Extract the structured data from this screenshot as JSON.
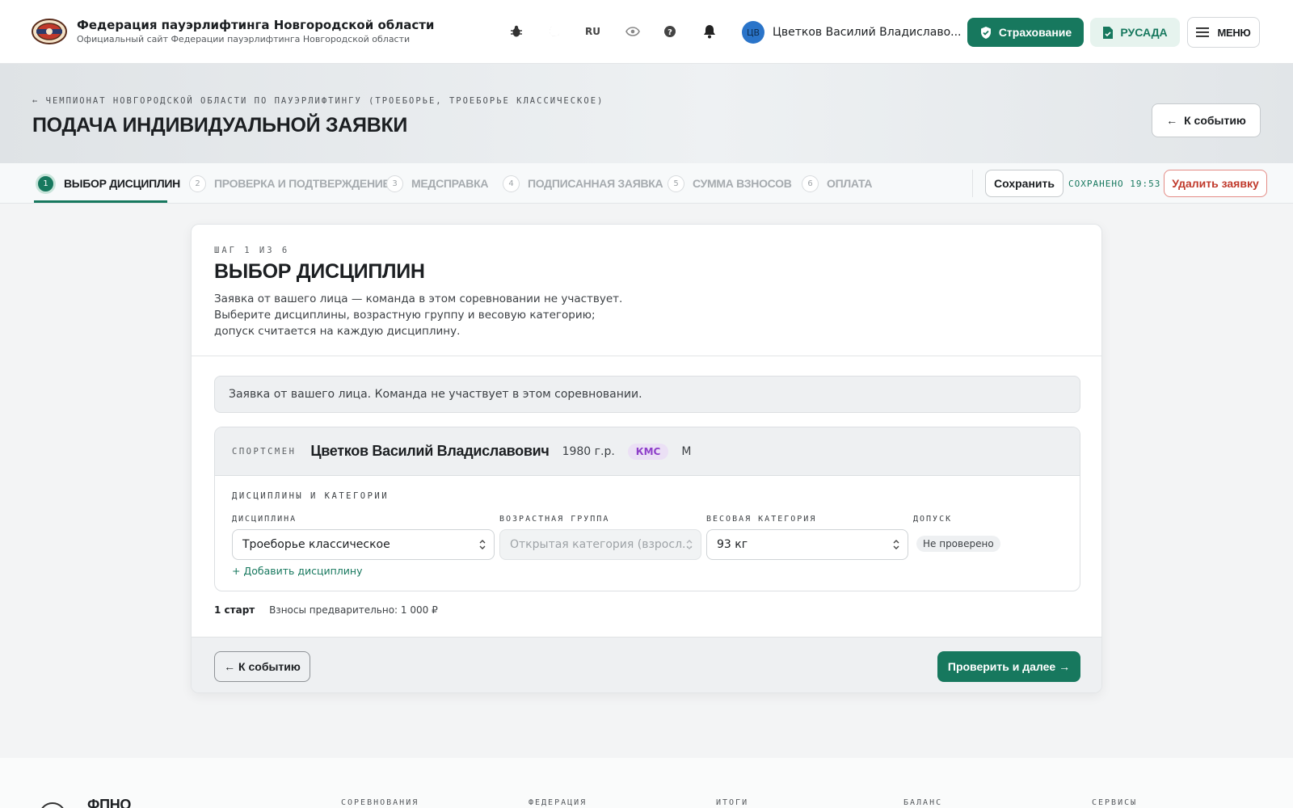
{
  "header": {
    "org_name": "Федерация пауэрлифтинга Новгородской области",
    "org_sub": "Официальный сайт Федерации пауэрлифтинга Новгородской области",
    "lang": "RU",
    "user_initials": "ЦВ",
    "user_name": "Цветков Василий Владиславо...",
    "insurance_label": "Страхование",
    "rusada_label": "РУСАДА",
    "menu_label": "МЕНЮ",
    "icons": [
      "bug-icon",
      "moon-icon",
      "eye-icon",
      "help-icon",
      "bell-icon"
    ]
  },
  "hero": {
    "breadcrumb": "ЧЕМПИОНАТ НОВГОРОДСКОЙ ОБЛАСТИ ПО ПАУЭРЛИФТИНГУ (ТРОЕБОРЬЕ, ТРОЕБОРЬЕ КЛАССИЧЕСКОЕ)",
    "title": "ПОДАЧА ИНДИВИДУАЛЬНОЙ ЗАЯВКИ",
    "back_label": "К событию"
  },
  "steps": [
    {
      "num": "1",
      "label": "ВЫБОР ДИСЦИПЛИН"
    },
    {
      "num": "2",
      "label": "ПРОВЕРКА И ПОДТВЕРЖДЕНИЕ"
    },
    {
      "num": "3",
      "label": "МЕДСПРАВКА"
    },
    {
      "num": "4",
      "label": "ПОДПИСАННАЯ ЗАЯВКА"
    },
    {
      "num": "5",
      "label": "СУММА ВЗНОСОВ"
    },
    {
      "num": "6",
      "label": "ОПЛАТА"
    }
  ],
  "toolbar": {
    "save_label": "Сохранить",
    "saved_status": "СОХРАНЕНО 19:53",
    "delete_label": "Удалить заявку"
  },
  "card": {
    "step_count": "ШАГ 1 ИЗ 6",
    "title": "ВЫБОР ДИСЦИПЛИН",
    "description": "Заявка от вашего лица — команда в этом соревновании не участвует. Выберите дисциплины, возрастную группу и весовую категорию; допуск считается на каждую дисциплину.",
    "notice": "Заявка от вашего лица. Команда не участвует в этом соревновании.",
    "athlete": {
      "label": "СПОРТСМЕН",
      "name": "Цветков Василий Владиславович",
      "year": "1980 г.р.",
      "rank": "КМС",
      "sex": "М"
    },
    "disciplines": {
      "title": "ДИСЦИПЛИНЫ И КАТЕГОРИИ",
      "col_discipline": "ДИСЦИПЛИНА",
      "col_age": "ВОЗРАСТНАЯ ГРУППА",
      "col_weight": "ВЕСОВАЯ КАТЕГОРИЯ",
      "col_admission": "ДОПУСК",
      "discipline_value": "Троеборье классическое",
      "age_value": "Открытая категория (взросл...",
      "weight_value": "93 кг",
      "admission_value": "Не проверено",
      "add_label": "+ Добавить дисциплину"
    },
    "summary_starts": "1 старт",
    "summary_fees": "Взносы предварительно: 1 000 ₽",
    "back_label": "← К событию",
    "next_label": "Проверить и далее →"
  },
  "footer": {
    "brand": "ФПНО",
    "cols": [
      "СОРЕВНОВАНИЯ",
      "ФЕДЕРАЦИЯ",
      "ИТОГИ",
      "БАЛАНС",
      "СЕРВИСЫ"
    ]
  },
  "colors": {
    "accent": "#17785e",
    "danger": "#c0392b",
    "badge": "#8e3fc9"
  }
}
